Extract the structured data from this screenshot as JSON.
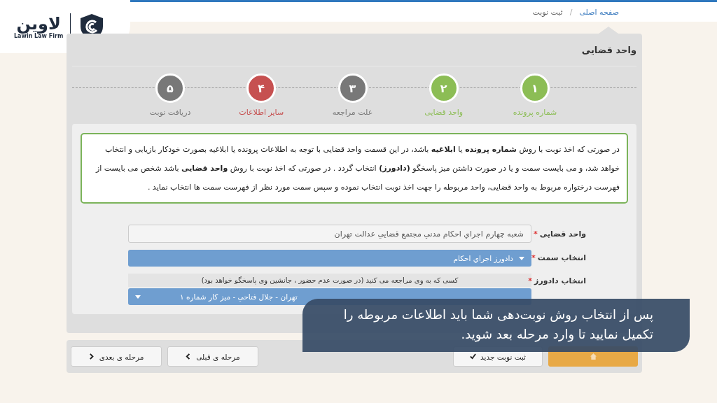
{
  "logo": {
    "wordmark": "لاوین",
    "caption": "Lawin Law Firm"
  },
  "breadcrumb": {
    "items": [
      {
        "label": "صفحه اصلی",
        "kind": "link"
      },
      {
        "label": "ثبت نوبت",
        "kind": "current"
      }
    ],
    "separator": "/"
  },
  "panel": {
    "title": "واحد قضایی"
  },
  "steps": [
    {
      "number": "۱",
      "label": "شماره پرونده",
      "color": "#8cbd55"
    },
    {
      "number": "۲",
      "label": "واحد قضایی",
      "color": "#8cbd55"
    },
    {
      "number": "۳",
      "label": "علت مراجعه",
      "color": "#787878"
    },
    {
      "number": "۴",
      "label": "سایر اطلاعات",
      "color": "#c65050"
    },
    {
      "number": "۵",
      "label": "دریافت نوبت",
      "color": "#787878"
    }
  ],
  "info": "در صورتی که اخذ نوبت با روش **شماره پرونده** یا **ابلاغیه** باشد، در این قسمت واحد قضایی با توجه به اطلاعات پرونده یا ابلاغیه بصورت خودکار بازیابی و انتخاب خواهد شد، و می بایست سمت و یا در صورت داشتن میز پاسخگو **(دادورز)** انتخاب گردد . در صورتی که اخذ نوبت با روش **واحد قضایی** باشد شخص می بایست از فهرست درختواره مربوط به واحد قضایی، واحد مربوطه را جهت اخذ نوبت انتخاب نموده و سپس سمت مورد نظر از فهرست سمت ها انتخاب نماید .",
  "fields": [
    {
      "kind": "text",
      "label": "واحد قضایی",
      "mark": "*",
      "value": "شعبه چهارم اجراي احكام مدني مجتمع قضايي عدالت تهران"
    },
    {
      "kind": "select",
      "label": "انتخاب سمت",
      "mark": "*",
      "value": "دادورز اجراي احكام"
    },
    {
      "kind": "select",
      "label": "انتخاب دادورز",
      "mark": "*",
      "hint": "کسی که به وی مراجعه می کنید (در صورت عدم حضور ، جانشین وی پاسخگو خواهد بود)",
      "value": "تهران - جلال فتاحي - ميز كار شماره ۱"
    }
  ],
  "buttons": [
    {
      "kind": "home"
    },
    {
      "kind": "new",
      "label": "ثبت نوبت جدید"
    },
    {
      "kind": "prev",
      "label": "مرحله ی قبلی"
    },
    {
      "kind": "next",
      "label": "مرحله ی بعدی"
    }
  ],
  "caption": "پس از انتخاب روش نوبت‌دهی شما باید اطلاعات مربوطه را تکمیل نمایید تا وارد مرحله بعد شوید."
}
